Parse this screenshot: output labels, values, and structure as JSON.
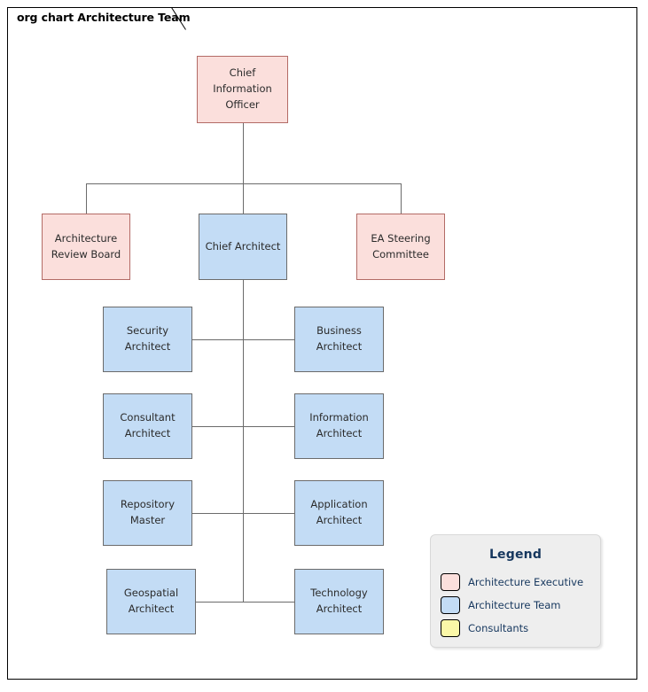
{
  "diagram": {
    "tab_title": "org chart Architecture Team",
    "type": "org-chart"
  },
  "colors": {
    "exec_fill": "#fbdfdc",
    "exec_border": "#b36b66",
    "team_fill": "#c3dcf5",
    "team_border": "#6b6b6b",
    "consultant_fill": "#fbf8a8",
    "consultant_border": "#000000",
    "connector": "#6b6b6b",
    "legend_bg": "#eeeeee",
    "legend_text": "#16375e",
    "frame_border": "#000000"
  },
  "nodes": {
    "cio": "Chief Information Officer",
    "arb": "Architecture Review Board",
    "chief_architect": "Chief Architect",
    "ea_steering": "EA Steering Committee",
    "security_architect": "Security Architect",
    "business_architect": "Business Architect",
    "consultant_architect": "Consultant Architect",
    "information_architect": "Information Architect",
    "repository_master": "Repository Master",
    "application_architect": "Application Architect",
    "geospatial_architect": "Geospatial Architect",
    "technology_architect": "Technology Architect"
  },
  "legend": {
    "title": "Legend",
    "items": [
      {
        "label": "Architecture Executive",
        "color": "#fbdfdc"
      },
      {
        "label": "Architecture Team",
        "color": "#c3dcf5"
      },
      {
        "label": "Consultants",
        "color": "#fbf8a8"
      }
    ]
  }
}
